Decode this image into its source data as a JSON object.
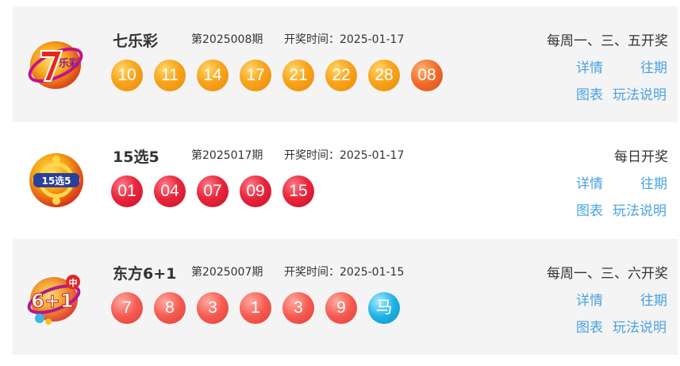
{
  "lotteries": [
    {
      "name": "七乐彩",
      "issue": "第2025008期",
      "time_label": "开奖时间：",
      "time": "2025-01-17",
      "schedule": "每周一、三、五开奖",
      "numbers": [
        "10",
        "11",
        "14",
        "17",
        "21",
        "22",
        "28",
        "08"
      ],
      "ball_colors": [
        "orange",
        "orange",
        "orange",
        "orange",
        "orange",
        "orange",
        "orange",
        "orange-dark"
      ],
      "links": {
        "detail": "详情",
        "history": "往期",
        "chart": "图表",
        "rules": "玩法说明"
      }
    },
    {
      "name": "15选5",
      "issue": "第2025017期",
      "time_label": "开奖时间：",
      "time": "2025-01-17",
      "schedule": "每日开奖",
      "numbers": [
        "01",
        "04",
        "07",
        "09",
        "15"
      ],
      "ball_colors": [
        "red",
        "red",
        "red",
        "red",
        "red"
      ],
      "links": {
        "detail": "详情",
        "history": "往期",
        "chart": "图表",
        "rules": "玩法说明"
      }
    },
    {
      "name": "东方6+1",
      "issue": "第2025007期",
      "time_label": "开奖时间：",
      "time": "2025-01-15",
      "schedule": "每周一、三、六开奖",
      "numbers": [
        "7",
        "8",
        "3",
        "1",
        "3",
        "9",
        "马"
      ],
      "ball_colors": [
        "salmon",
        "salmon",
        "salmon",
        "salmon",
        "salmon",
        "salmon",
        "blue"
      ],
      "links": {
        "detail": "详情",
        "history": "往期",
        "chart": "图表",
        "rules": "玩法说明"
      }
    }
  ],
  "logos": {
    "qlc": {
      "icon": "qilecai-logo-icon",
      "text_main": "7",
      "text_sub": "乐彩"
    },
    "x155": {
      "icon": "15xuan5-logo-icon",
      "text_main": "15选5"
    },
    "df61": {
      "icon": "dongfang61-logo-icon",
      "text_main": "6+1",
      "text_sub": "中"
    }
  }
}
